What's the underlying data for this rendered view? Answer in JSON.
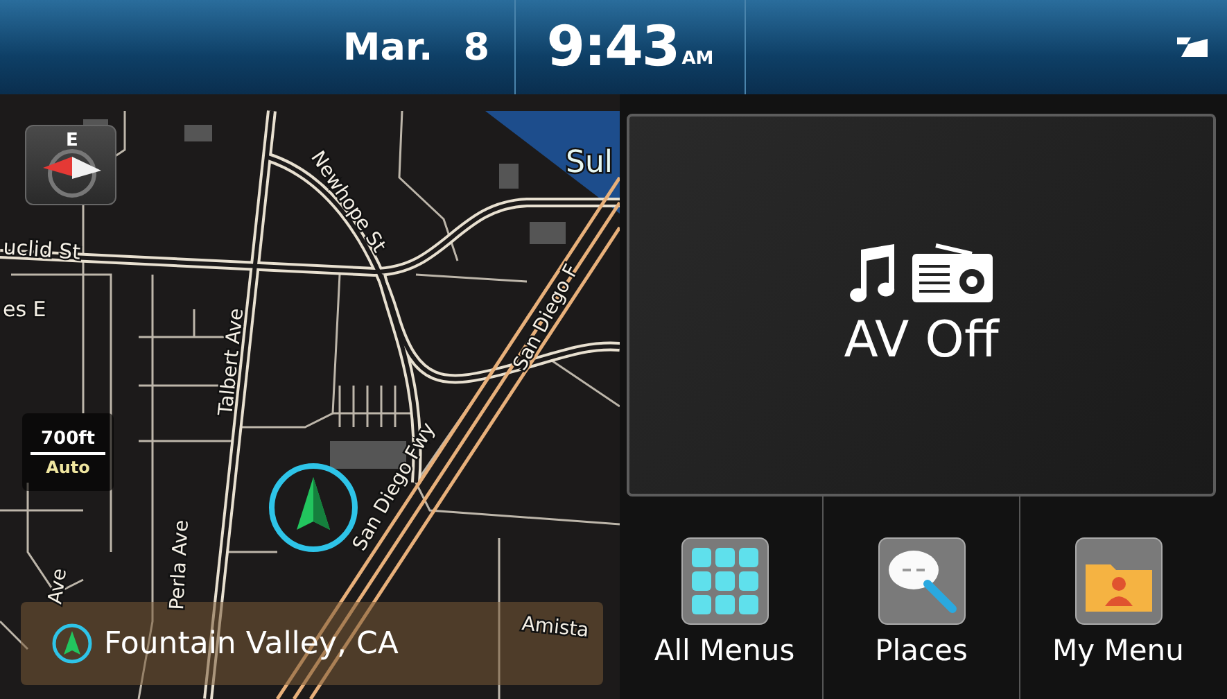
{
  "status_bar": {
    "month": "Mar.",
    "day": "8",
    "time": "9:43",
    "meridiem": "AM"
  },
  "map": {
    "compass_heading": "E",
    "labels": [
      "Sul",
      "uclid St",
      "es E",
      "Newhope St",
      "Talbert Ave",
      "San Diego Fwy",
      "San Diego F",
      "Perla Ave",
      "Ave",
      "Amista"
    ],
    "scale": {
      "distance": "700ft",
      "mode": "Auto"
    },
    "location": "Fountain Valley, CA"
  },
  "av_panel": {
    "label": "AV Off"
  },
  "shortcuts": [
    {
      "kind": "grid",
      "label": "All Menus"
    },
    {
      "kind": "places",
      "label": "Places"
    },
    {
      "kind": "my_menu",
      "label": "My Menu"
    }
  ]
}
